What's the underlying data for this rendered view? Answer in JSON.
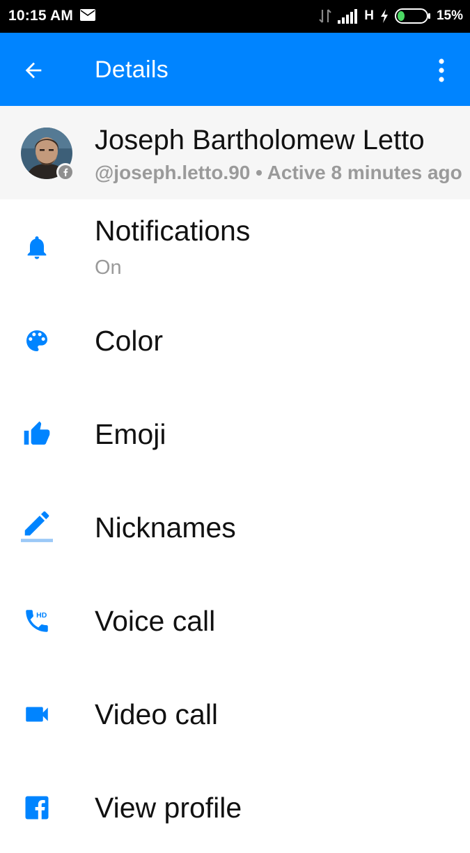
{
  "status_bar": {
    "time": "10:15 AM",
    "network": "H",
    "battery_percent": "15%",
    "battery_level": 0.15,
    "icons": [
      "mail-icon",
      "data-transfer-icon",
      "signal-icon",
      "charging-icon",
      "battery-icon"
    ]
  },
  "app_bar": {
    "title": "Details",
    "back_icon": "arrow-back-icon",
    "more_icon": "more-vert-icon",
    "color": "#0084ff"
  },
  "profile": {
    "name": "Joseph Bartholomew Letto",
    "username": "@joseph.letto.90",
    "separator": " • ",
    "status": "Active 8 minutes ago",
    "badge_icon": "facebook-badge-icon"
  },
  "settings": {
    "accent_color": "#0084ff",
    "items": [
      {
        "icon": "bell-icon",
        "label": "Notifications",
        "sublabel": "On"
      },
      {
        "icon": "palette-icon",
        "label": "Color"
      },
      {
        "icon": "thumbs-up-icon",
        "label": "Emoji"
      },
      {
        "icon": "pencil-icon",
        "label": "Nicknames"
      },
      {
        "icon": "hd-phone-icon",
        "label": "Voice call"
      },
      {
        "icon": "video-camera-icon",
        "label": "Video call"
      },
      {
        "icon": "facebook-icon",
        "label": "View profile"
      }
    ]
  }
}
